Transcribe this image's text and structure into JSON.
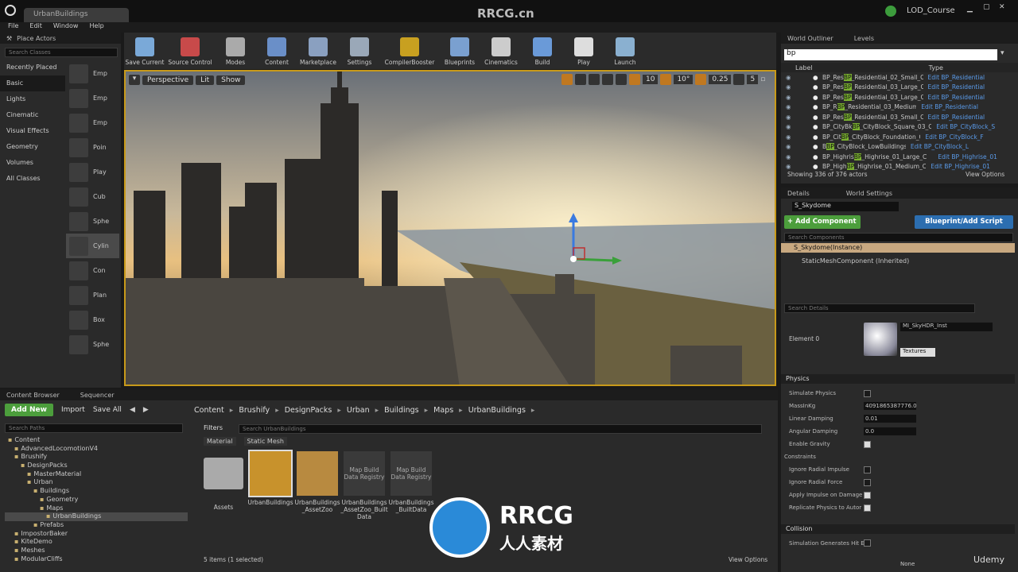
{
  "window": {
    "tab": "UrbanBuildings",
    "project": "LOD_Course",
    "watermark": "RRCG.cn"
  },
  "menu": [
    "File",
    "Edit",
    "Window",
    "Help"
  ],
  "place_actors": {
    "tab": "Place Actors",
    "search_placeholder": "Search Classes",
    "categories": [
      "Recently Placed",
      "Basic",
      "Lights",
      "Cinematic",
      "Visual Effects",
      "Geometry",
      "Volumes",
      "All Classes"
    ],
    "active_category": "Basic",
    "actors": [
      "Emp",
      "Emp",
      "Emp",
      "Poin",
      "Play",
      "Cub",
      "Sphe",
      "Cylin",
      "Con",
      "Plan",
      "Box",
      "Sphe"
    ]
  },
  "toolbar": [
    {
      "label": "Save Current",
      "icon": "save-icon",
      "color": "#7aa9d8"
    },
    {
      "label": "Source Control",
      "icon": "source-control-icon",
      "color": "#c84a4a"
    },
    {
      "label": "Modes",
      "icon": "modes-icon",
      "color": "#aaaaaa"
    },
    {
      "label": "Content",
      "icon": "content-icon",
      "color": "#6a8fc8"
    },
    {
      "label": "Marketplace",
      "icon": "marketplace-icon",
      "color": "#8aa0c0"
    },
    {
      "label": "Settings",
      "icon": "settings-icon",
      "color": "#9aa8b8"
    },
    {
      "label": "CompilerBooster",
      "icon": "compiler-booster-icon",
      "color": "#c8a020"
    },
    {
      "label": "Blueprints",
      "icon": "blueprints-icon",
      "color": "#7aa0d0"
    },
    {
      "label": "Cinematics",
      "icon": "cinematics-icon",
      "color": "#cccccc"
    },
    {
      "label": "Build",
      "icon": "build-icon",
      "color": "#6a9ad8"
    },
    {
      "label": "Play",
      "icon": "play-icon",
      "color": "#dddddd"
    },
    {
      "label": "Launch",
      "icon": "launch-icon",
      "color": "#8ab0d0"
    }
  ],
  "viewport": {
    "perspective": "Perspective",
    "lit": "Lit",
    "show": "Show",
    "grid": "10",
    "angle": "10°",
    "scale": "0.25",
    "cam": "5"
  },
  "outliner": {
    "tabs": [
      "World Outliner",
      "Levels"
    ],
    "search": "bp",
    "col_label": "Label",
    "col_type": "Type",
    "rows": [
      {
        "pre": "BP_Res",
        "hl": "BP",
        "post": "_Residential_02_Small_C",
        "type": "Edit BP_Residential"
      },
      {
        "pre": "BP_Res",
        "hl": "BP",
        "post": "_Residential_03_Large_C",
        "type": "Edit BP_Residential"
      },
      {
        "pre": "BP_Res",
        "hl": "BP",
        "post": "_Residential_03_Large_C",
        "type": "Edit BP_Residential"
      },
      {
        "pre": "BP_R",
        "hl": "BP",
        "post": "_Residential_03_Medium_C",
        "type": "Edit BP_Residential"
      },
      {
        "pre": "BP_Res",
        "hl": "BP",
        "post": "_Residential_03_Small_C",
        "type": "Edit BP_Residential"
      },
      {
        "pre": "BP_CityBk",
        "hl": "BP",
        "post": "_CityBlock_Square_03_C",
        "type": "Edit BP_CityBlock_S"
      },
      {
        "pre": "BP_Cit",
        "hl": "BP",
        "post": "_CityBlock_Foundation_C",
        "type": "Edit BP_CityBlock_F"
      },
      {
        "pre": "B",
        "hl": "BP",
        "post": "_CityBlock_LowBuildings_01_C",
        "type": "Edit BP_CityBlock_L"
      },
      {
        "pre": "BP_Highris",
        "hl": "BP",
        "post": "_Highrise_01_Large_C",
        "type": "Edit BP_Highrise_01"
      },
      {
        "pre": "BP_High",
        "hl": "BP",
        "post": "_Highrise_01_Medium_C",
        "type": "Edit BP_Highrise_01"
      }
    ],
    "status": "Showing 336 of 376 actors",
    "view_options": "View Options"
  },
  "details": {
    "tabs": [
      "Details",
      "World Settings"
    ],
    "name": "S_Skydome",
    "add_component": "+ Add Component",
    "blueprint": "Blueprint/Add Script",
    "search_components": "Search Components",
    "instance": "S_Skydome(Instance)",
    "component": "StaticMeshComponent (Inherited)",
    "search_details": "Search Details",
    "element": "Element 0",
    "material": "MI_SkyHDR_Inst",
    "textures": "Textures",
    "physics": "Physics",
    "props": [
      {
        "name": "Simulate Physics",
        "type": "cb",
        "on": false
      },
      {
        "name": "MassInKg",
        "type": "val",
        "val": "4091865387776.0"
      },
      {
        "name": "Linear Damping",
        "type": "val",
        "val": "0.01"
      },
      {
        "name": "Angular Damping",
        "type": "val",
        "val": "0.0"
      },
      {
        "name": "Enable Gravity",
        "type": "cb",
        "on": true
      },
      {
        "name": "Constraints",
        "type": "sect"
      },
      {
        "name": "Ignore Radial Impulse",
        "type": "cb",
        "on": false
      },
      {
        "name": "Ignore Radial Force",
        "type": "cb",
        "on": false
      },
      {
        "name": "Apply Impulse on Damage",
        "type": "cb",
        "on": true
      },
      {
        "name": "Replicate Physics to Autor",
        "type": "cb",
        "on": true
      }
    ],
    "collision": "Collision",
    "sim_hit": "Simulation Generates Hit E",
    "none": "None"
  },
  "content_browser": {
    "tabs": [
      "Content Browser",
      "Sequencer"
    ],
    "add_new": "Add New",
    "import": "Import",
    "save_all": "Save All",
    "breadcrumb": [
      "Content",
      "Brushify",
      "DesignPacks",
      "Urban",
      "Buildings",
      "Maps",
      "UrbanBuildings"
    ],
    "search_paths": "Search Paths",
    "filters": "Filters",
    "search_assets": "Search UrbanBuildings",
    "filter_chips": [
      "Material",
      "Static Mesh"
    ],
    "tree": [
      {
        "label": "Content",
        "d": 0
      },
      {
        "label": "AdvancedLocomotionV4",
        "d": 1
      },
      {
        "label": "Brushify",
        "d": 1
      },
      {
        "label": "DesignPacks",
        "d": 2
      },
      {
        "label": "MasterMaterial",
        "d": 3
      },
      {
        "label": "Urban",
        "d": 3
      },
      {
        "label": "Buildings",
        "d": 4
      },
      {
        "label": "Geometry",
        "d": 5
      },
      {
        "label": "Maps",
        "d": 5
      },
      {
        "label": "UrbanBuildings",
        "d": 6,
        "sel": true
      },
      {
        "label": "Prefabs",
        "d": 4
      },
      {
        "label": "ImpostorBaker",
        "d": 1
      },
      {
        "label": "KiteDemo",
        "d": 1
      },
      {
        "label": "Meshes",
        "d": 1
      },
      {
        "label": "ModularCliffs",
        "d": 1
      }
    ],
    "assets": [
      {
        "label": "Assets",
        "kind": "folder"
      },
      {
        "label": "UrbanBuildings",
        "kind": "map",
        "sel": true
      },
      {
        "label": "UrbanBuildings_AssetZoo",
        "kind": "map"
      },
      {
        "label": "UrbanBuildings_AssetZoo_BuiltData",
        "kind": "reg",
        "tile": "Map Build Data Registry"
      },
      {
        "label": "UrbanBuildings_BuiltData",
        "kind": "reg",
        "tile": "Map Build Data Registry"
      }
    ],
    "status": "5 items (1 selected)",
    "view_options": "View Options"
  },
  "logo": {
    "top": "RRCG",
    "bottom": "人人素材",
    "udemy": "Udemy"
  }
}
